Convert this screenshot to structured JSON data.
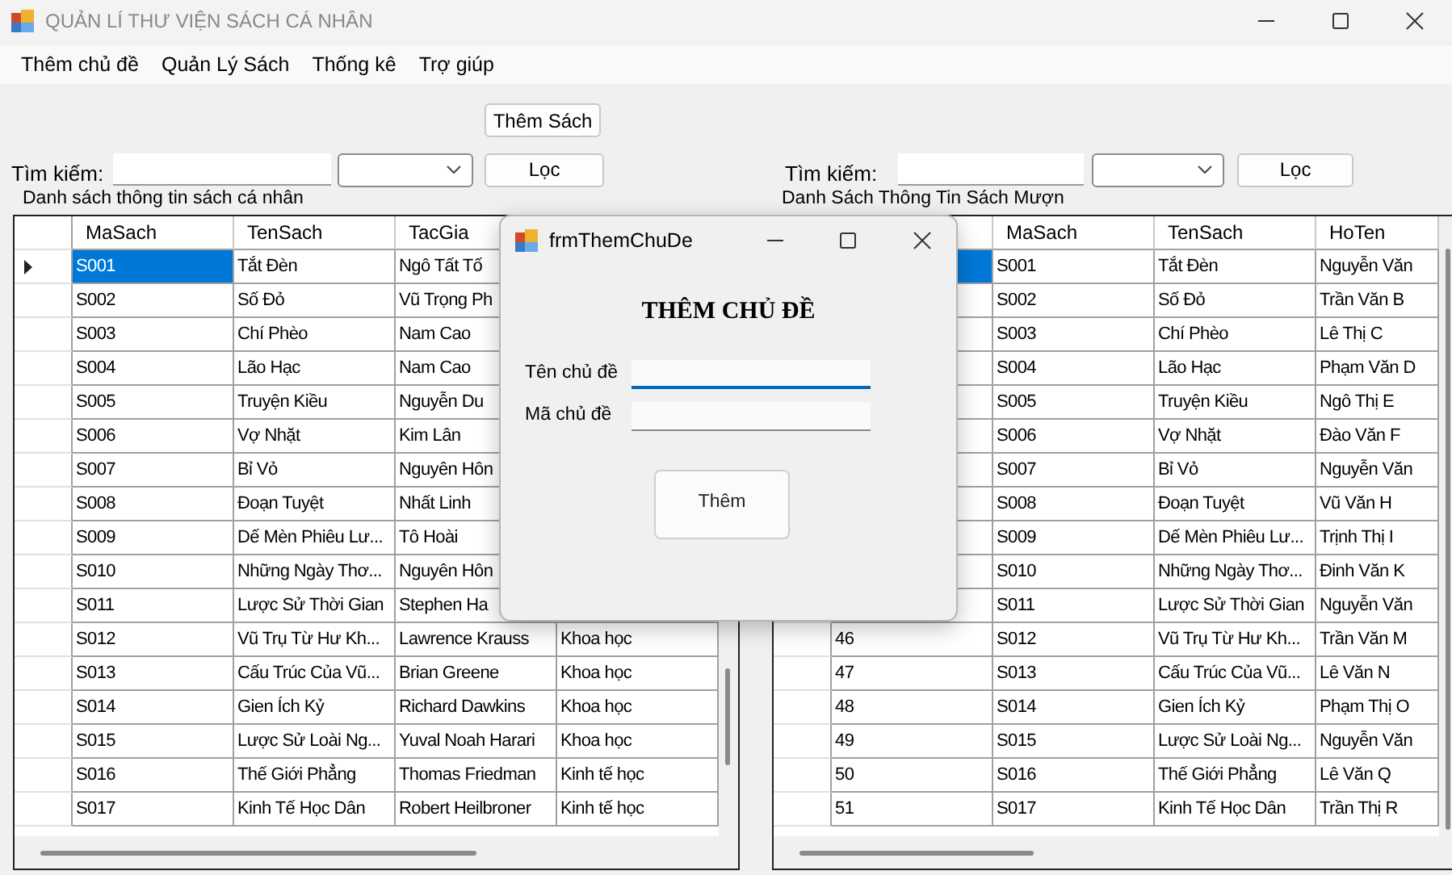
{
  "window": {
    "title": "QUẢN LÍ THƯ VIỆN SÁCH CÁ NHÂN"
  },
  "menu": [
    {
      "label": "Thêm chủ đề"
    },
    {
      "label": "Quản Lý Sách"
    },
    {
      "label": "Thống kê"
    },
    {
      "label": "Trợ giúp"
    }
  ],
  "add_book_button": "Thêm Sách",
  "panels": [
    {
      "search_label": "Tìm kiếm:",
      "filter_button": "Lọc",
      "group_title": "Danh sách thông tin sách cá nhân",
      "current_row_arrow": true,
      "columns": [
        {
          "label": "MaSach"
        },
        {
          "label": "TenSach"
        },
        {
          "label": "TacGia"
        }
      ],
      "rows": [
        {
          "selected": true,
          "cells": [
            "S001",
            "Tắt Đèn",
            "Ngô Tất Tố",
            null
          ]
        },
        {
          "selected": false,
          "cells": [
            "S002",
            "Số Đỏ",
            "Vũ Trọng Ph",
            null
          ]
        },
        {
          "selected": false,
          "cells": [
            "S003",
            "Chí Phèo",
            "Nam Cao",
            null
          ]
        },
        {
          "selected": false,
          "cells": [
            "S004",
            "Lão Hạc",
            "Nam Cao",
            null
          ]
        },
        {
          "selected": false,
          "cells": [
            "S005",
            "Truyện Kiều",
            "Nguyễn Du",
            null
          ]
        },
        {
          "selected": false,
          "cells": [
            "S006",
            "Vợ Nhặt",
            "Kim Lân",
            null
          ]
        },
        {
          "selected": false,
          "cells": [
            "S007",
            "Bỉ Vỏ",
            "Nguyên Hôn",
            null
          ]
        },
        {
          "selected": false,
          "cells": [
            "S008",
            "Đoạn Tuyệt",
            "Nhất Linh",
            null
          ]
        },
        {
          "selected": false,
          "cells": [
            "S009",
            "Dế Mèn Phiêu Lư...",
            "Tô Hoài",
            null
          ]
        },
        {
          "selected": false,
          "cells": [
            "S010",
            "Những Ngày Thơ...",
            "Nguyên Hôn",
            null
          ]
        },
        {
          "selected": false,
          "cells": [
            "S011",
            "Lược Sử Thời Gian",
            "Stephen Ha",
            null
          ]
        },
        {
          "selected": false,
          "cells": [
            "S012",
            "Vũ Trụ Từ Hư Kh...",
            "Lawrence Krauss",
            "Khoa học"
          ]
        },
        {
          "selected": false,
          "cells": [
            "S013",
            "Cấu Trúc Của Vũ...",
            "Brian Greene",
            "Khoa học"
          ]
        },
        {
          "selected": false,
          "cells": [
            "S014",
            "Gien Ích Kỷ",
            "Richard Dawkins",
            "Khoa học"
          ]
        },
        {
          "selected": false,
          "cells": [
            "S015",
            "Lược Sử Loài Ng...",
            "Yuval Noah Harari",
            "Khoa học"
          ]
        },
        {
          "selected": false,
          "cells": [
            "S016",
            "Thế Giới Phẳng",
            "Thomas Friedman",
            "Kinh tế học"
          ]
        },
        {
          "selected": false,
          "cells": [
            "S017",
            "Kinh Tế Học Dân",
            "Robert Heilbroner",
            "Kinh tế học"
          ]
        }
      ]
    },
    {
      "search_label": "Tìm kiếm:",
      "filter_button": "Lọc",
      "group_title": "Danh Sách Thông Tin Sách Mượn",
      "columns": [
        {},
        {
          "label": "MaSach"
        },
        {
          "label": "TenSach"
        },
        {
          "label": "HoTen"
        }
      ],
      "rows": [
        {
          "selected": true,
          "cells": [
            null,
            "S001",
            "Tắt Đèn",
            "Nguyễn Văn"
          ]
        },
        {
          "selected": false,
          "cells": [
            null,
            "S002",
            "Số Đỏ",
            "Trần Văn B"
          ]
        },
        {
          "selected": false,
          "cells": [
            null,
            "S003",
            "Chí Phèo",
            "Lê Thị C"
          ]
        },
        {
          "selected": false,
          "cells": [
            null,
            "S004",
            "Lão Hạc",
            "Phạm Văn D"
          ]
        },
        {
          "selected": false,
          "cells": [
            null,
            "S005",
            "Truyện Kiều",
            "Ngô Thị E"
          ]
        },
        {
          "selected": false,
          "cells": [
            null,
            "S006",
            "Vợ Nhặt",
            "Đào Văn F"
          ]
        },
        {
          "selected": false,
          "cells": [
            null,
            "S007",
            "Bỉ Vỏ",
            "Nguyễn Văn"
          ]
        },
        {
          "selected": false,
          "cells": [
            null,
            "S008",
            "Đoạn Tuyệt",
            "Vũ Văn H"
          ]
        },
        {
          "selected": false,
          "cells": [
            null,
            "S009",
            "Dế Mèn Phiêu Lư...",
            "Trịnh Thị I"
          ]
        },
        {
          "selected": false,
          "cells": [
            null,
            "S010",
            "Những Ngày Thơ...",
            "Đinh Văn K"
          ]
        },
        {
          "selected": false,
          "cells": [
            null,
            "S011",
            "Lược Sử Thời Gian",
            "Nguyễn Văn"
          ]
        },
        {
          "selected": false,
          "cells": [
            "46",
            "S012",
            "Vũ Trụ Từ Hư Kh...",
            "Trần Văn M"
          ]
        },
        {
          "selected": false,
          "cells": [
            "47",
            "S013",
            "Cấu Trúc Của Vũ...",
            "Lê Văn N"
          ]
        },
        {
          "selected": false,
          "cells": [
            "48",
            "S014",
            "Gien Ích Kỷ",
            "Phạm Thị O"
          ]
        },
        {
          "selected": false,
          "cells": [
            "49",
            "S015",
            "Lược Sử Loài Ng...",
            "Nguyễn Văn"
          ]
        },
        {
          "selected": false,
          "cells": [
            "50",
            "S016",
            "Thế Giới Phẳng",
            "Lê Văn Q"
          ]
        },
        {
          "selected": false,
          "cells": [
            "51",
            "S017",
            "Kinh Tế Học Dân",
            "Trần Thị R"
          ]
        }
      ]
    }
  ],
  "dialog": {
    "title": "frmThemChuDe",
    "heading": "THÊM CHỦ ĐỀ",
    "fields": [
      {
        "label": "Tên chủ đề",
        "focused": true
      },
      {
        "label": "Mã chủ đề",
        "focused": false
      }
    ],
    "button": "Thêm"
  }
}
